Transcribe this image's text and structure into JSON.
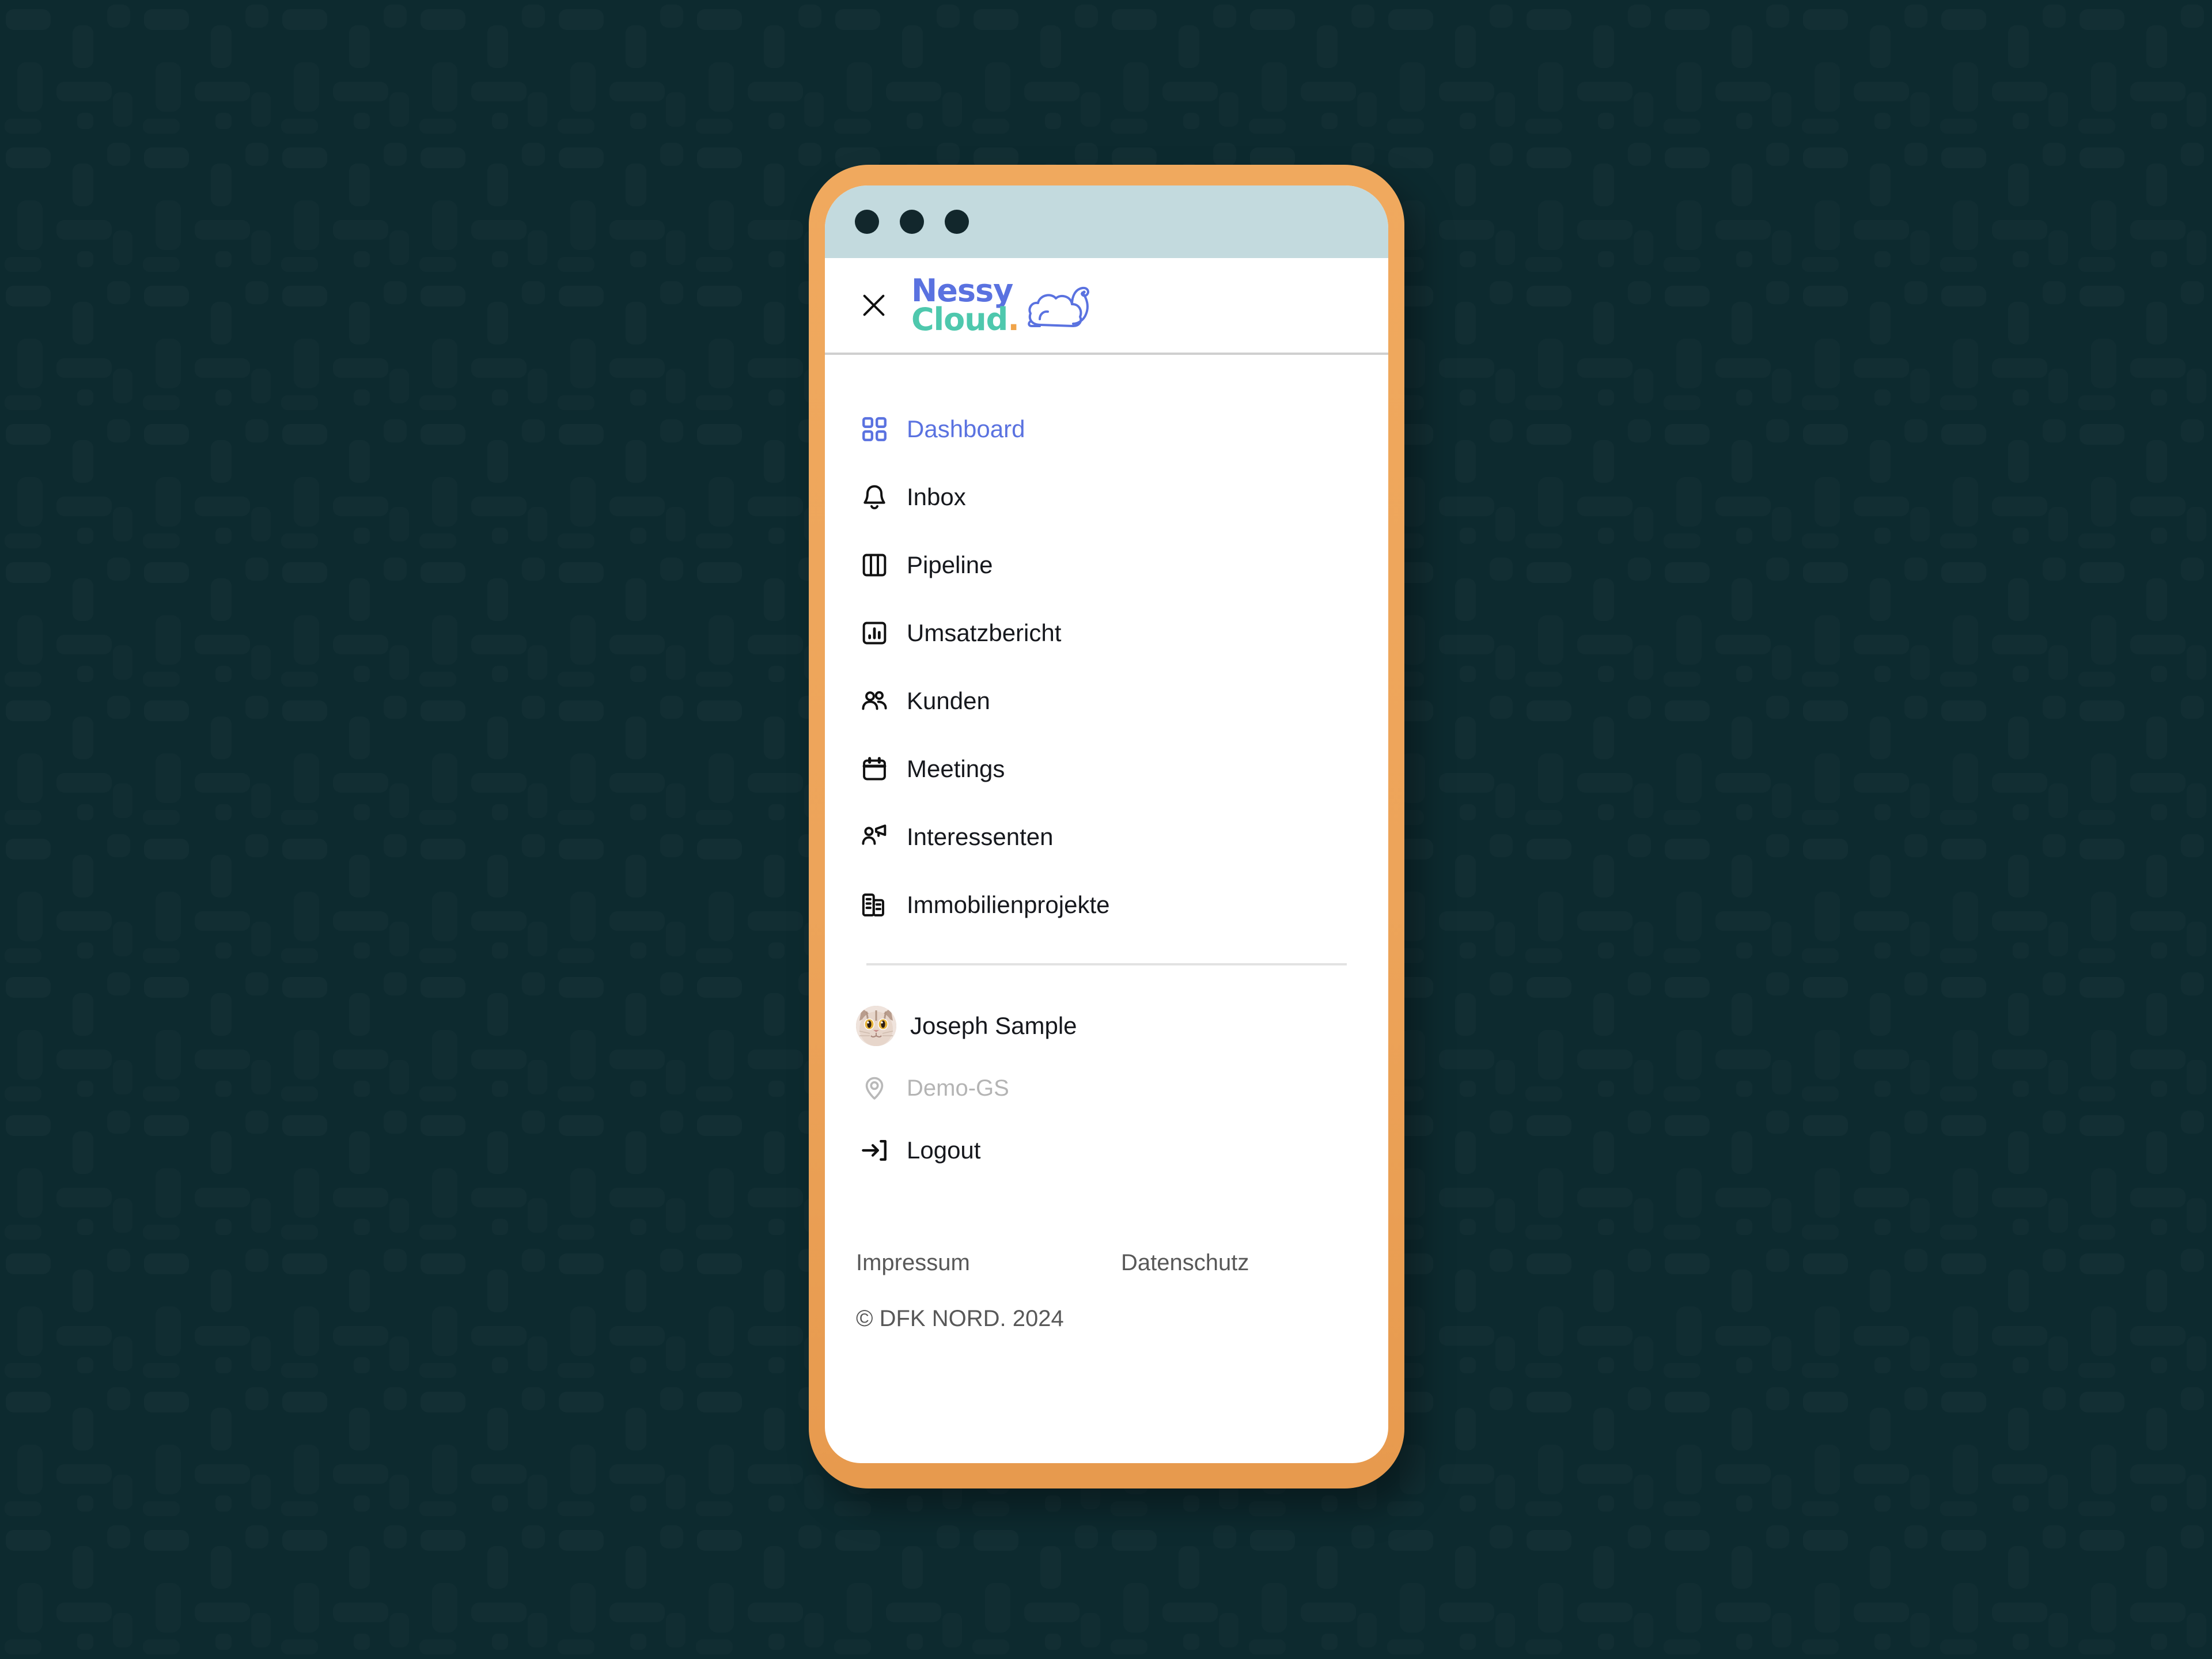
{
  "window": {
    "dots": [
      "close-dot",
      "minimize-dot",
      "maximize-dot"
    ]
  },
  "header": {
    "close_icon": "close-icon",
    "brand": {
      "line1": "Nessy",
      "line2": "Cloud",
      "dot": ".",
      "mascot_icon": "cloud-flex-arm-icon",
      "color_line1": "#5a72e0",
      "color_line2": "#4ec8ad",
      "color_dot": "#f0a44a"
    }
  },
  "nav": {
    "active_index": 0,
    "active_color": "#5a72e0",
    "items": [
      {
        "label": "Dashboard",
        "icon": "grid-squares-icon"
      },
      {
        "label": "Inbox",
        "icon": "bell-icon"
      },
      {
        "label": "Pipeline",
        "icon": "columns-icon"
      },
      {
        "label": "Umsatzbericht",
        "icon": "bar-chart-icon"
      },
      {
        "label": "Kunden",
        "icon": "users-icon"
      },
      {
        "label": "Meetings",
        "icon": "calendar-icon"
      },
      {
        "label": "Interessenten",
        "icon": "person-megaphone-icon"
      },
      {
        "label": "Immobilienprojekte",
        "icon": "buildings-icon"
      }
    ]
  },
  "user": {
    "name": "Joseph Sample",
    "avatar_icon": "cat-avatar",
    "location": "Demo-GS",
    "location_icon": "map-pin-icon",
    "logout_label": "Logout",
    "logout_icon": "logout-arrow-icon"
  },
  "footer": {
    "impressum": "Impressum",
    "datenschutz": "Datenschutz",
    "copyright": "© DFK NORD. 2024"
  },
  "theme": {
    "page_background": "#0d2a2f",
    "device_frame": "#eda45a",
    "titlebar": "#c3dade",
    "screen": "#ffffff",
    "text": "#16181d",
    "muted_text": "#b4b4b4",
    "footer_text": "#585858"
  }
}
